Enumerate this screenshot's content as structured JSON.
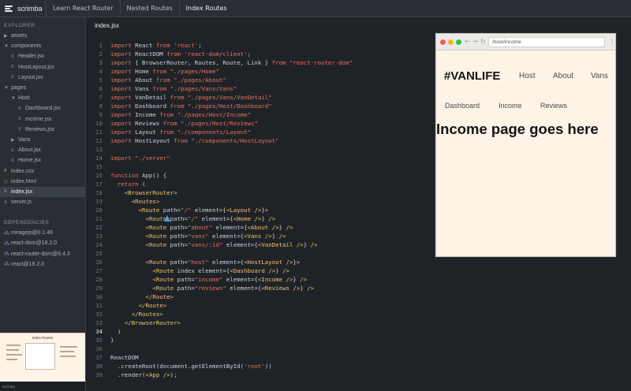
{
  "topbar": {
    "logo_text": "scrimba",
    "breadcrumbs": [
      "Learn React Router",
      "Nested Routes",
      "Index Routes"
    ]
  },
  "sidebar": {
    "explorer_heading": "EXPLORER",
    "tree": [
      {
        "label": "assets",
        "type": "folder",
        "depth": 0
      },
      {
        "label": "components",
        "type": "folder-open",
        "depth": 0
      },
      {
        "label": "Header.jsx",
        "type": "js",
        "depth": 1
      },
      {
        "label": "HostLayout.jsx",
        "type": "js",
        "depth": 1
      },
      {
        "label": "Layout.jsx",
        "type": "js",
        "depth": 1
      },
      {
        "label": "pages",
        "type": "folder-open",
        "depth": 0
      },
      {
        "label": "Host",
        "type": "folder-open",
        "depth": 1
      },
      {
        "label": "Dashboard.jsx",
        "type": "js",
        "depth": 2
      },
      {
        "label": "Income.jsx",
        "type": "js",
        "depth": 2
      },
      {
        "label": "Reviews.jsx",
        "type": "js",
        "depth": 2
      },
      {
        "label": "Vans",
        "type": "folder",
        "depth": 1
      },
      {
        "label": "About.jsx",
        "type": "js",
        "depth": 1
      },
      {
        "label": "Home.jsx",
        "type": "js",
        "depth": 1
      },
      {
        "label": "index.css",
        "type": "css",
        "depth": 0
      },
      {
        "label": "index.html",
        "type": "html",
        "depth": 0
      },
      {
        "label": "index.jsx",
        "type": "js",
        "depth": 0,
        "active": true
      },
      {
        "label": "server.js",
        "type": "js",
        "depth": 0
      }
    ],
    "dependencies_heading": "DEPENDENCIES",
    "dependencies": [
      "miragejs@0.1.46",
      "react-dom@18.2.0",
      "react-router-dom@6.4.3",
      "react@18.2.0"
    ],
    "thumbnail_title": "Index Routes",
    "bottom_text": "scrimba"
  },
  "editor": {
    "tab_label": "index.jsx",
    "current_line": 34,
    "lines": [
      [
        {
          "t": "import",
          "c": "kw"
        },
        {
          "t": " React "
        },
        {
          "t": "from",
          "c": "kw"
        },
        {
          "t": " "
        },
        {
          "t": "'react'",
          "c": "str"
        },
        {
          "t": ";"
        }
      ],
      [
        {
          "t": "import",
          "c": "kw"
        },
        {
          "t": " ReactDOM "
        },
        {
          "t": "from",
          "c": "kw"
        },
        {
          "t": " "
        },
        {
          "t": "'react-dom/client'",
          "c": "str"
        },
        {
          "t": ";"
        }
      ],
      [
        {
          "t": "import",
          "c": "kw"
        },
        {
          "t": " { BrowserRouter, Routes, Route, Link } "
        },
        {
          "t": "from",
          "c": "kw"
        },
        {
          "t": " "
        },
        {
          "t": "\"react-router-dom\"",
          "c": "str"
        }
      ],
      [
        {
          "t": "import",
          "c": "kw"
        },
        {
          "t": " Home "
        },
        {
          "t": "from",
          "c": "kw"
        },
        {
          "t": " "
        },
        {
          "t": "\"./pages/Home\"",
          "c": "str"
        }
      ],
      [
        {
          "t": "import",
          "c": "kw"
        },
        {
          "t": " About "
        },
        {
          "t": "from",
          "c": "kw"
        },
        {
          "t": " "
        },
        {
          "t": "\"./pages/About\"",
          "c": "str"
        }
      ],
      [
        {
          "t": "import",
          "c": "kw"
        },
        {
          "t": " Vans "
        },
        {
          "t": "from",
          "c": "kw"
        },
        {
          "t": " "
        },
        {
          "t": "\"./pages/Vans/Vans\"",
          "c": "str"
        }
      ],
      [
        {
          "t": "import",
          "c": "kw"
        },
        {
          "t": " VanDetail "
        },
        {
          "t": "from",
          "c": "kw"
        },
        {
          "t": " "
        },
        {
          "t": "\"./pages/Vans/VanDetail\"",
          "c": "str"
        }
      ],
      [
        {
          "t": "import",
          "c": "kw"
        },
        {
          "t": " Dashboard "
        },
        {
          "t": "from",
          "c": "kw"
        },
        {
          "t": " "
        },
        {
          "t": "\"./pages/Host/Dashboard\"",
          "c": "str"
        }
      ],
      [
        {
          "t": "import",
          "c": "kw"
        },
        {
          "t": " Income "
        },
        {
          "t": "from",
          "c": "kw"
        },
        {
          "t": " "
        },
        {
          "t": "\"./pages/Host/Income\"",
          "c": "str"
        }
      ],
      [
        {
          "t": "import",
          "c": "kw"
        },
        {
          "t": " Reviews "
        },
        {
          "t": "from",
          "c": "kw"
        },
        {
          "t": " "
        },
        {
          "t": "\"./pages/Host/Reviews\"",
          "c": "str"
        }
      ],
      [
        {
          "t": "import",
          "c": "kw"
        },
        {
          "t": " Layout "
        },
        {
          "t": "from",
          "c": "kw"
        },
        {
          "t": " "
        },
        {
          "t": "\"./components/Layout\"",
          "c": "str"
        }
      ],
      [
        {
          "t": "import",
          "c": "kw"
        },
        {
          "t": " HostLayout "
        },
        {
          "t": "from",
          "c": "kw"
        },
        {
          "t": " "
        },
        {
          "t": "\"./components/HostLayout\"",
          "c": "str"
        }
      ],
      [],
      [
        {
          "t": "import",
          "c": "kw"
        },
        {
          "t": " "
        },
        {
          "t": "\"./server\"",
          "c": "str"
        }
      ],
      [],
      [
        {
          "t": "function",
          "c": "kw"
        },
        {
          "t": " App() {"
        }
      ],
      [
        {
          "t": "  "
        },
        {
          "t": "return",
          "c": "kw"
        },
        {
          "t": " ("
        }
      ],
      [
        {
          "t": "    "
        },
        {
          "t": "<BrowserRouter>",
          "c": "tag"
        }
      ],
      [
        {
          "t": "      "
        },
        {
          "t": "<Routes>",
          "c": "tag"
        }
      ],
      [
        {
          "t": "        "
        },
        {
          "t": "<Route",
          "c": "tag"
        },
        {
          "t": " path="
        },
        {
          "t": "\"/\"",
          "c": "str"
        },
        {
          "t": " element={"
        },
        {
          "t": "<Layout />",
          "c": "tag"
        },
        {
          "t": "}"
        },
        {
          "t": ">",
          "c": "tag"
        }
      ],
      [
        {
          "t": "          "
        },
        {
          "t": "<Route",
          "c": "tag"
        },
        {
          "t": " path="
        },
        {
          "t": "\"/\"",
          "c": "str"
        },
        {
          "t": " element={"
        },
        {
          "t": "<Home />",
          "c": "tag"
        },
        {
          "t": "} "
        },
        {
          "t": "/>",
          "c": "tag"
        }
      ],
      [
        {
          "t": "          "
        },
        {
          "t": "<Route",
          "c": "tag"
        },
        {
          "t": " path="
        },
        {
          "t": "\"about\"",
          "c": "str"
        },
        {
          "t": " element={"
        },
        {
          "t": "<About />",
          "c": "tag"
        },
        {
          "t": "} "
        },
        {
          "t": "/>",
          "c": "tag"
        }
      ],
      [
        {
          "t": "          "
        },
        {
          "t": "<Route",
          "c": "tag"
        },
        {
          "t": " path="
        },
        {
          "t": "\"vans\"",
          "c": "str"
        },
        {
          "t": " element={"
        },
        {
          "t": "<Vans />",
          "c": "tag"
        },
        {
          "t": "} "
        },
        {
          "t": "/>",
          "c": "tag"
        }
      ],
      [
        {
          "t": "          "
        },
        {
          "t": "<Route",
          "c": "tag"
        },
        {
          "t": " path="
        },
        {
          "t": "\"vans/:id\"",
          "c": "str"
        },
        {
          "t": " element={"
        },
        {
          "t": "<VanDetail />",
          "c": "tag"
        },
        {
          "t": "} "
        },
        {
          "t": "/>",
          "c": "tag"
        }
      ],
      [],
      [
        {
          "t": "          "
        },
        {
          "t": "<Route",
          "c": "tag"
        },
        {
          "t": " path="
        },
        {
          "t": "\"host\"",
          "c": "str"
        },
        {
          "t": " element={"
        },
        {
          "t": "<HostLayout />",
          "c": "tag"
        },
        {
          "t": "}"
        },
        {
          "t": ">",
          "c": "tag"
        }
      ],
      [
        {
          "t": "            "
        },
        {
          "t": "<Route",
          "c": "tag"
        },
        {
          "t": " index element={"
        },
        {
          "t": "<Dashboard />",
          "c": "tag"
        },
        {
          "t": "} "
        },
        {
          "t": "/>",
          "c": "tag"
        }
      ],
      [
        {
          "t": "            "
        },
        {
          "t": "<Route",
          "c": "tag"
        },
        {
          "t": " path="
        },
        {
          "t": "\"income\"",
          "c": "str"
        },
        {
          "t": " element={"
        },
        {
          "t": "<Income />",
          "c": "tag"
        },
        {
          "t": "} "
        },
        {
          "t": "/>",
          "c": "tag"
        }
      ],
      [
        {
          "t": "            "
        },
        {
          "t": "<Route",
          "c": "tag"
        },
        {
          "t": " path="
        },
        {
          "t": "\"reviews\"",
          "c": "str"
        },
        {
          "t": " element={"
        },
        {
          "t": "<Reviews />",
          "c": "tag"
        },
        {
          "t": "} "
        },
        {
          "t": "/>",
          "c": "tag"
        }
      ],
      [
        {
          "t": "          "
        },
        {
          "t": "</Route>",
          "c": "tag"
        }
      ],
      [
        {
          "t": "        "
        },
        {
          "t": "</Route>",
          "c": "tag"
        }
      ],
      [
        {
          "t": "      "
        },
        {
          "t": "</Routes>",
          "c": "tag"
        }
      ],
      [
        {
          "t": "    "
        },
        {
          "t": "</BrowserRouter>",
          "c": "tag"
        }
      ],
      [
        {
          "t": "  )"
        }
      ],
      [
        {
          "t": "}"
        }
      ],
      [],
      [
        {
          "t": "ReactDOM"
        }
      ],
      [
        {
          "t": "  .createRoot(document.getElementById("
        },
        {
          "t": "'root'",
          "c": "str"
        },
        {
          "t": "))"
        }
      ],
      [
        {
          "t": "  .render("
        },
        {
          "t": "<App />",
          "c": "tag"
        },
        {
          "t": ");"
        }
      ]
    ]
  },
  "preview": {
    "url": "/host/income",
    "brand": "#VANLIFE",
    "nav": [
      "Host",
      "About",
      "Vans"
    ],
    "host_nav": [
      "Dashboard",
      "Income",
      "Reviews"
    ],
    "heading": "Income page goes here"
  },
  "colors": {
    "editor_bg": "#1f2328",
    "keyword": "#e8715a",
    "tag": "#f0c36b",
    "preview_bg": "#fdf3e6"
  }
}
